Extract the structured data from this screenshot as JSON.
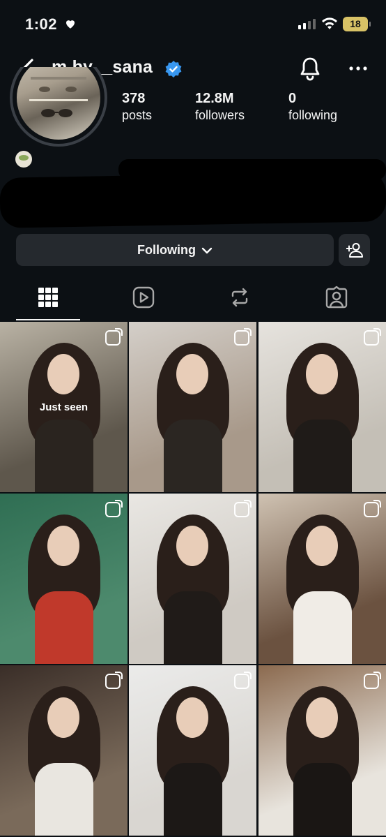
{
  "status_bar": {
    "time": "1:02",
    "battery": "18"
  },
  "header": {
    "username": "m.by__sana"
  },
  "profile": {
    "stats": [
      {
        "value": "378",
        "label": "posts"
      },
      {
        "value": "12.8M",
        "label": "followers"
      },
      {
        "value": "0",
        "label": "following"
      }
    ]
  },
  "actions": {
    "following_label": "Following"
  },
  "tabs": [
    {
      "icon": "grid-icon",
      "active": true
    },
    {
      "icon": "reels-icon",
      "active": false
    },
    {
      "icon": "reposts-icon",
      "active": false
    },
    {
      "icon": "tagged-icon",
      "active": false
    }
  ],
  "grid": {
    "just_seen_label": "Just seen",
    "tiles": [
      {
        "scene": "beige interior, model in black top",
        "colors": [
          "#b9b2a4",
          "#5e574c",
          "#2a241f"
        ]
      },
      {
        "scene": "hotel room, model in black top",
        "colors": [
          "#d4cfc9",
          "#a8998a",
          "#2b2622"
        ]
      },
      {
        "scene": "white curtains, model in black top",
        "colors": [
          "#e6e3de",
          "#c4bfb6",
          "#1f1b18"
        ]
      },
      {
        "scene": "green arched window set",
        "colors": [
          "#2f6e53",
          "#4d8a6d",
          "#c0392b"
        ]
      },
      {
        "scene": "white room, model in black top",
        "colors": [
          "#e9e7e3",
          "#cfcac3",
          "#201b18"
        ]
      },
      {
        "scene": "hair styling close-up",
        "colors": [
          "#cfc2b2",
          "#6b5240",
          "#f0ece6"
        ]
      },
      {
        "scene": "dark interior, striped shirt",
        "colors": [
          "#3a2e28",
          "#7a6a5a",
          "#e9e6e0"
        ]
      },
      {
        "scene": "white backdrop portrait",
        "colors": [
          "#ebebea",
          "#d9d6d1",
          "#1c1816"
        ]
      },
      {
        "scene": "bedroom, seated on bed",
        "colors": [
          "#8b6a4f",
          "#e8e4dd",
          "#1a1614"
        ]
      }
    ]
  },
  "colors": {
    "background": "#0c1014",
    "button": "#25292e",
    "verified": "#3897f0"
  }
}
